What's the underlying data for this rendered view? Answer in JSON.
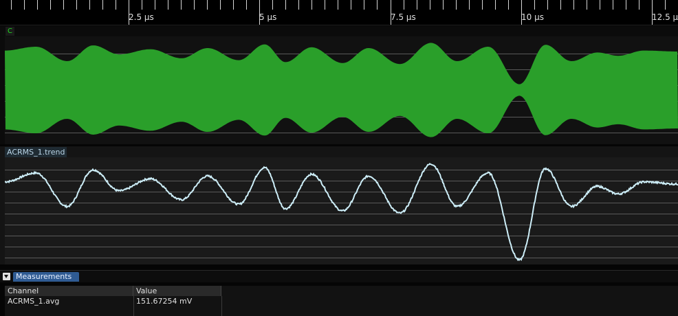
{
  "timeline": {
    "unit": "µs",
    "major_ticks": [
      {
        "value": 2.5,
        "label": "2.5 µs"
      },
      {
        "value": 5,
        "label": "5 µs"
      },
      {
        "value": 7.5,
        "label": "7.5 µs"
      },
      {
        "value": 10,
        "label": "10 µs"
      },
      {
        "value": 12.5,
        "label": "12.5 µs"
      }
    ],
    "minor_step": 0.25
  },
  "channels": [
    {
      "tag": "C",
      "color": "#2a9f2a",
      "type": "raw-waveform"
    },
    {
      "name": "ACRMS_1.trend",
      "color": "#cdeef8",
      "type": "trend"
    }
  ],
  "measurements": {
    "tab_label": "Measurements",
    "toggle_icon": "collapse-triangle-icon",
    "columns": [
      "Channel",
      "Value"
    ],
    "rows": [
      {
        "channel": "ACRMS_1.avg",
        "value": "151.67254 mV"
      }
    ]
  },
  "chart_data": {
    "type": "line",
    "x_unit": "µs",
    "xlim": [
      0,
      12.95
    ],
    "series": [
      {
        "name": "ACRMS_1.trend",
        "x": [
          0,
          0.6,
          1.2,
          1.7,
          2.2,
          2.8,
          3.4,
          3.9,
          4.5,
          5.0,
          5.4,
          5.9,
          6.5,
          7.0,
          7.6,
          8.2,
          8.7,
          9.3,
          9.9,
          10.4,
          10.9,
          11.4,
          11.8,
          12.3,
          12.95
        ],
        "y": [
          0.55,
          0.75,
          0.0,
          0.82,
          0.35,
          0.62,
          0.15,
          0.68,
          0.05,
          0.87,
          -0.05,
          0.72,
          -0.1,
          0.68,
          -0.15,
          0.95,
          -0.0,
          0.75,
          -1.2,
          0.85,
          -0.0,
          0.45,
          0.28,
          0.55,
          0.5
        ]
      }
    ]
  }
}
